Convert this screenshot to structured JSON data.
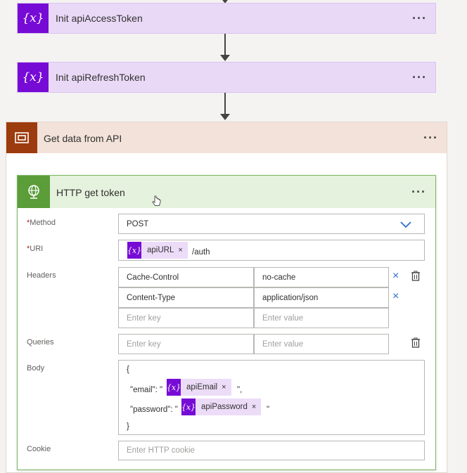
{
  "actions": [
    {
      "title": "Init apiAccessToken",
      "icon": "variable-icon",
      "icon_text": "{x}"
    },
    {
      "title": "Init apiRefreshToken",
      "icon": "variable-icon",
      "icon_text": "{x}"
    }
  ],
  "more_glyph": "···",
  "scope": {
    "title": "Get data from API",
    "icon": "scope-icon"
  },
  "http": {
    "title": "HTTP get token",
    "icon": "globe-icon",
    "method": {
      "label": "Method",
      "required_mark": "*",
      "value": "POST"
    },
    "uri": {
      "label": "URI",
      "required_mark": "*",
      "token": "apiURL",
      "suffix": "/auth"
    },
    "headers": {
      "label": "Headers",
      "rows": [
        {
          "key": "Cache-Control",
          "value": "no-cache"
        },
        {
          "key": "Content-Type",
          "value": "application/json"
        }
      ],
      "key_placeholder": "Enter key",
      "value_placeholder": "Enter value"
    },
    "queries": {
      "label": "Queries",
      "key_placeholder": "Enter key",
      "value_placeholder": "Enter value"
    },
    "body": {
      "label": "Body",
      "open_brace": "{",
      "close_brace": "}",
      "line1_prefix": "\"email\": \"",
      "line1_token": "apiEmail",
      "line1_suffix": "\",",
      "line2_prefix": "\"password\": \"",
      "line2_token": "apiPassword",
      "line2_suffix": "\""
    },
    "cookie": {
      "label": "Cookie",
      "placeholder": "Enter HTTP cookie"
    }
  },
  "token_icon_text": "{x}",
  "remove_glyph": "×",
  "colors": {
    "variable_accent": "#770bd6",
    "variable_header": "#e9d9f7",
    "scope_accent": "#9c3b0d",
    "scope_header": "#f2e2d9",
    "http_accent": "#5b9d39",
    "http_header": "#e5f2dd",
    "link_blue": "#2b6fcf"
  }
}
